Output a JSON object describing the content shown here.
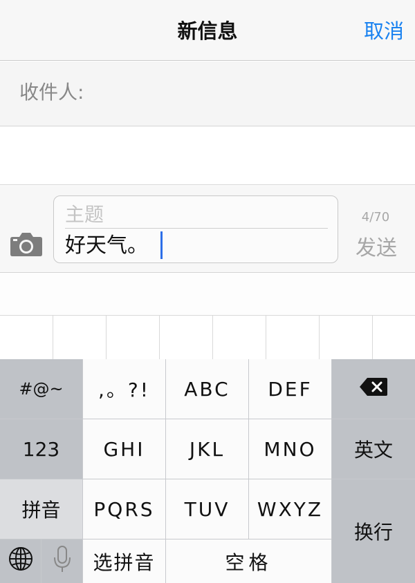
{
  "nav": {
    "title": "新信息",
    "cancel_label": "取消"
  },
  "recipient": {
    "label": "收件人:"
  },
  "compose": {
    "subject_placeholder": "主题",
    "body_text": "好天气。",
    "counter": "4/70",
    "send_label": "发送"
  },
  "keyboard": {
    "row1": {
      "symbols": "#@~",
      "punct": ",。?!",
      "abc": "ABC",
      "def": "DEF",
      "delete_icon": "delete-icon"
    },
    "row2": {
      "num": "123",
      "ghi": "GHI",
      "jkl": "JKL",
      "mno": "MNO",
      "english": "英文"
    },
    "row3": {
      "pinyin": "拼音",
      "pqrs": "PQRS",
      "tuv": "TUV",
      "wxyz": "WXYZ"
    },
    "row4": {
      "globe_icon": "globe-icon",
      "mic_icon": "microphone-icon",
      "choose_pinyin": "选拼音",
      "space": "空格"
    },
    "return_label": "换行"
  },
  "colors": {
    "accent": "#1a82f0",
    "caret": "#2d6ee8",
    "key_light": "#fbfbfb",
    "key_dark": "#bfc2c7"
  }
}
